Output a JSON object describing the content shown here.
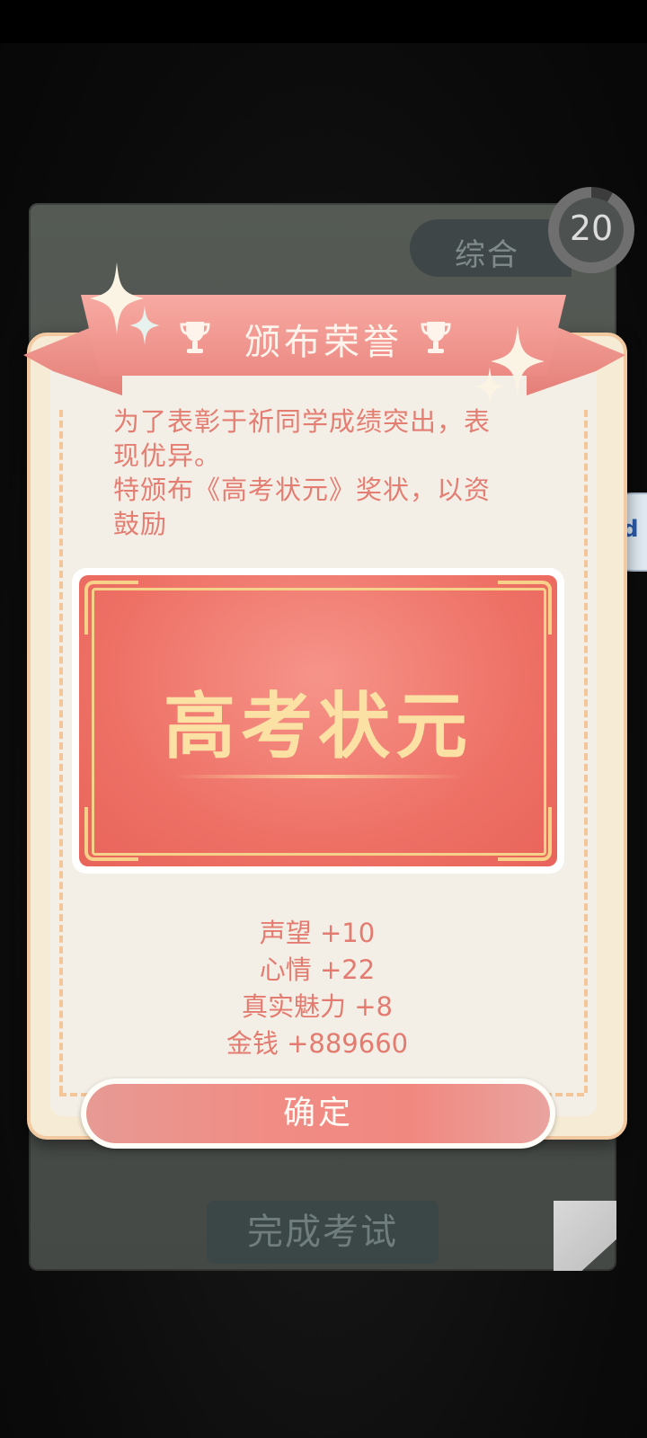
{
  "exam": {
    "subject": "综合",
    "timer": "20",
    "finish_label": "完成考试"
  },
  "modal": {
    "title": "颁布荣誉",
    "message": [
      "为了表彰于祈同学成绩突出，表",
      "现优异。",
      "特颁布《高考状元》奖状，以资",
      "鼓励"
    ],
    "certificate_title": "高考状元",
    "rewards": [
      "声望 +10",
      "心情 +22",
      "真实魅力 +8",
      "金钱 +889660"
    ],
    "confirm_label": "确定"
  },
  "side_badge": {
    "glyph": "d"
  },
  "colors": {
    "accent_pink": "#ec8a84",
    "text_red": "#e47d72",
    "gold": "#fbe2a4",
    "card_gray": "#4a4f4b"
  },
  "icons": [
    "trophy-icon",
    "sparkle-icon",
    "page-fold-icon"
  ]
}
